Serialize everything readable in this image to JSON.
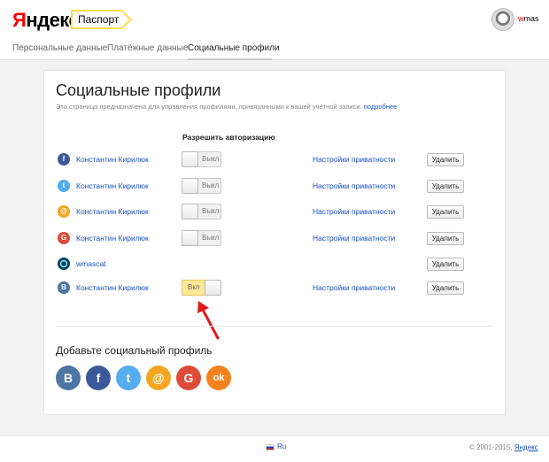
{
  "header": {
    "logo_ya": "Я",
    "logo_rest": "ндекс",
    "passport_label": "Паспорт",
    "username_first": "w",
    "username_rest": "mas"
  },
  "tabs": [
    {
      "label": "Персональные данные"
    },
    {
      "label": "Платёжные данные"
    },
    {
      "label": "Социальные профили"
    }
  ],
  "main": {
    "title": "Социальные профили",
    "subtitle": "Эта страница предназначена для управления профилями, привязанными к вашей учётной записи.",
    "subtitle_link": "подробнее",
    "column_header": "Разрешить авторизацию",
    "privacy_label": "Настройки приватности",
    "delete_label": "Удалить",
    "profiles": [
      {
        "network": "facebook",
        "icon": "facebook-icon",
        "letter": "f",
        "color": "#3b5998",
        "name": "Константин Кирилюк",
        "toggle": "Выкл"
      },
      {
        "network": "twitter",
        "icon": "twitter-icon",
        "letter": "t",
        "color": "#55acee",
        "name": "Константин Кирилюк",
        "toggle": "Выкл"
      },
      {
        "network": "mailru",
        "icon": "mailru-icon",
        "letter": "@",
        "color": "#f5a623",
        "name": "Константин Кирилюк",
        "toggle": "Выкл"
      },
      {
        "network": "google",
        "icon": "google-icon",
        "letter": "G",
        "color": "#dd4b39",
        "name": "Константин Кирилюк",
        "toggle": "Выкл"
      },
      {
        "network": "livejournal",
        "icon": "livejournal-icon",
        "letter": "",
        "color": "#004359",
        "name": "wmascat",
        "toggle": ""
      },
      {
        "network": "vkontakte",
        "icon": "vk-icon",
        "letter": "B",
        "color": "#4c75a3",
        "name": "Константин Кирилюк",
        "toggle": "Вкл"
      }
    ],
    "add_title": "Добавьте социальный профиль",
    "add_icons": [
      {
        "icon": "vk-icon",
        "letter": "B",
        "color": "#4c75a3"
      },
      {
        "icon": "facebook-icon",
        "letter": "f",
        "color": "#3b5998"
      },
      {
        "icon": "twitter-icon",
        "letter": "t",
        "color": "#55acee"
      },
      {
        "icon": "mailru-icon",
        "letter": "@",
        "color": "#f5a623"
      },
      {
        "icon": "google-icon",
        "letter": "G",
        "color": "#dd4b39"
      },
      {
        "icon": "odnoklassniki-icon",
        "letter": "ok",
        "color": "#f58220"
      }
    ]
  },
  "footer": {
    "lang": "Ru",
    "copyright": "© 2001-2015,",
    "copyright_link": "Яндекс"
  },
  "colors": {
    "link": "#1a4fc4",
    "accent_yellow": "#ffdb4d",
    "toggle_on": "#ffe898",
    "annotation_arrow": "#e0191b"
  }
}
